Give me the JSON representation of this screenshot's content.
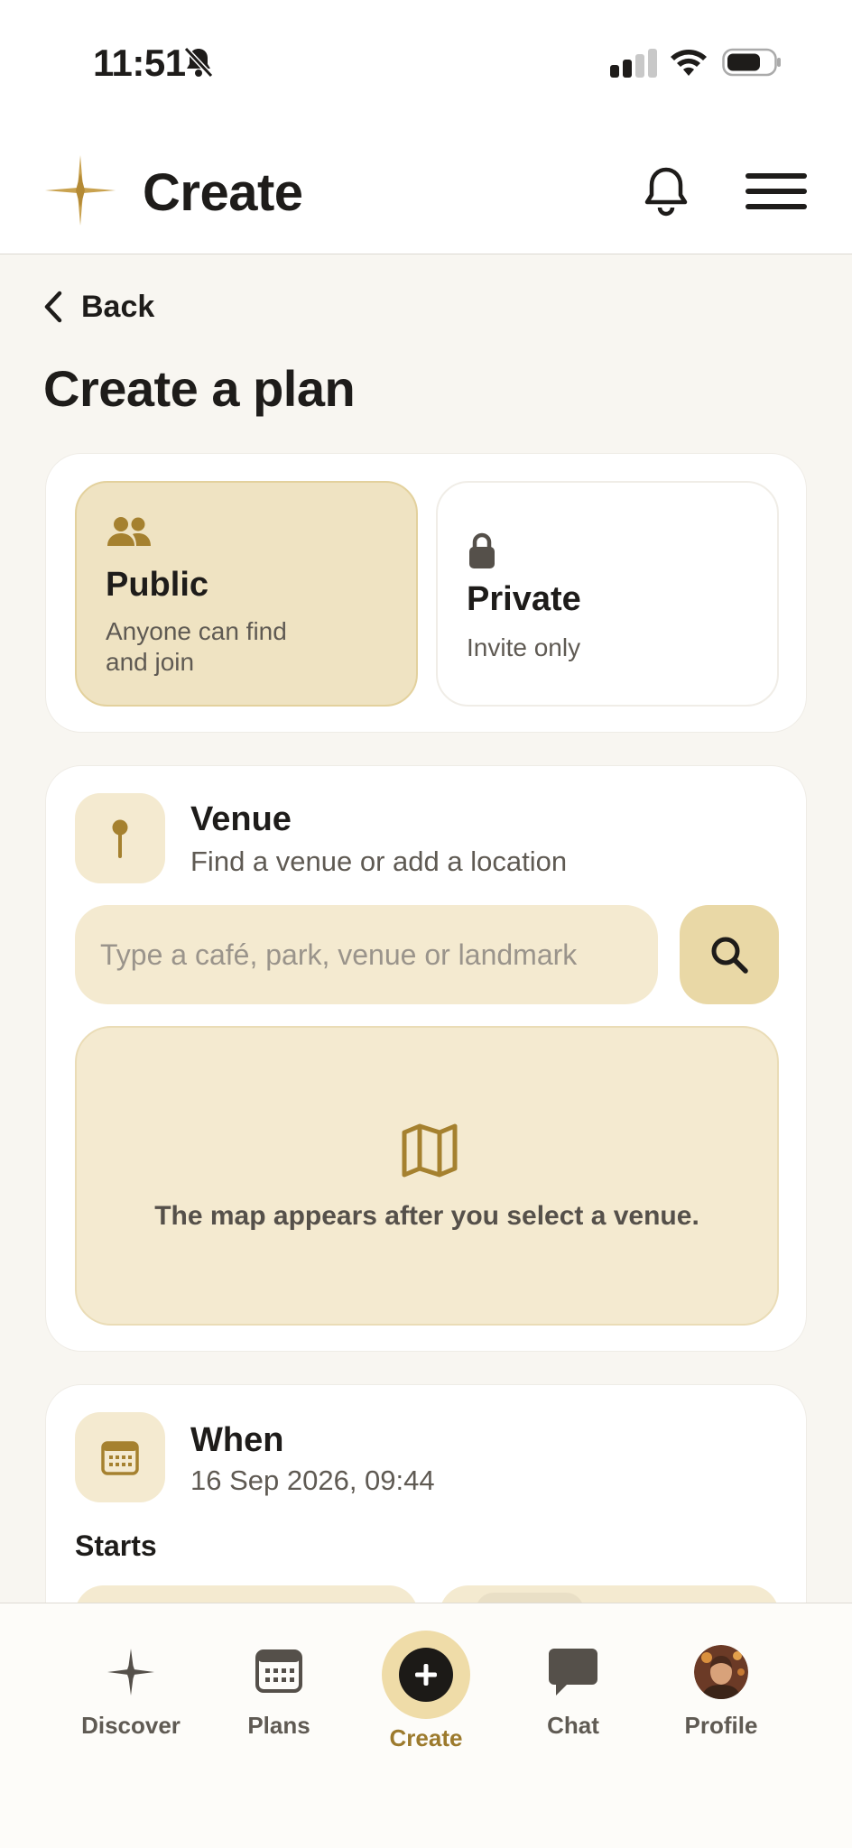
{
  "status_bar": {
    "time": "11:51"
  },
  "header": {
    "title": "Create",
    "logo_icon": "sparkle-star-icon",
    "notification_icon": "bell-icon",
    "menu_icon": "hamburger-menu-icon"
  },
  "page": {
    "back_label": "Back",
    "title": "Create a plan"
  },
  "visibility": {
    "selected": "public",
    "public": {
      "title": "Public",
      "description": "Anyone can find and join",
      "icon": "people-icon"
    },
    "private": {
      "title": "Private",
      "description": "Invite only",
      "icon": "lock-icon"
    }
  },
  "venue": {
    "title": "Venue",
    "subtitle": "Find a venue or add a location",
    "icon": "pin-icon",
    "input_value": "",
    "input_placeholder": "Type a café, park, venue or landmark",
    "search_icon": "search-icon",
    "map_icon": "map-icon",
    "map_message": "The map appears after you select a venue."
  },
  "when": {
    "title": "When",
    "subtitle": "16 Sep 2026, 09:44",
    "icon": "calendar-icon",
    "starts_label": "Starts"
  },
  "bottom_nav": {
    "active": "create",
    "items": [
      {
        "key": "discover",
        "label": "Discover",
        "icon": "sparkle-icon"
      },
      {
        "key": "plans",
        "label": "Plans",
        "icon": "calendar-icon"
      },
      {
        "key": "create",
        "label": "Create",
        "icon": "plus-circle-icon"
      },
      {
        "key": "chat",
        "label": "Chat",
        "icon": "chat-bubble-icon"
      },
      {
        "key": "profile",
        "label": "Profile",
        "icon": "avatar"
      }
    ]
  },
  "colors": {
    "accent_gold": "#9c7a2d",
    "selected_card_bg": "#efe3c2",
    "field_bg": "#f4ead0",
    "page_bg": "#f8f6f1"
  }
}
